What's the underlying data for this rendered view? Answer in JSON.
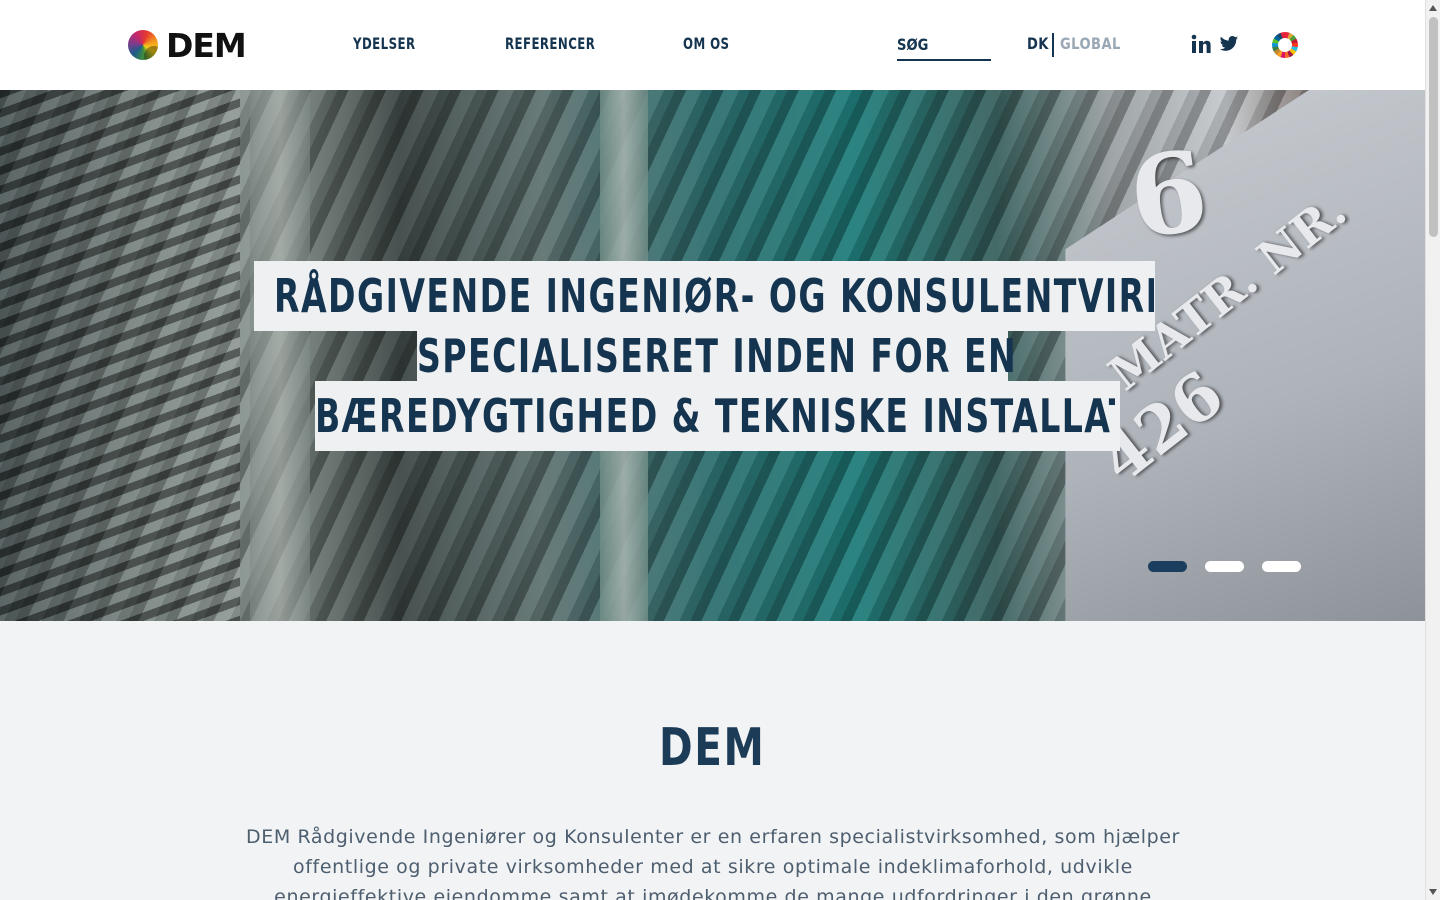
{
  "brand": {
    "logo_text": "DEM"
  },
  "nav": {
    "items": [
      {
        "label": "YDELSER"
      },
      {
        "label": "REFERENCER"
      },
      {
        "label": "OM OS"
      }
    ],
    "search_placeholder": "SØG",
    "lang_dk": "DK",
    "lang_global": "GLOBAL",
    "social": [
      {
        "icon": "linkedin-icon"
      },
      {
        "icon": "twitter-icon"
      }
    ],
    "sdg_icon": "sdg-wheel-icon"
  },
  "hero": {
    "lines": [
      "RÅDGIVENDE INGENIØR- OG KONSULENTVIRKSOMHED",
      "SPECIALISERET INDEN FOR ENERGI,",
      "BÆREDYGTIGHED & TEKNISKE INSTALLATIONER"
    ],
    "plate_number": "6",
    "plate_label": "MATR. NR.",
    "plate_code": "426",
    "slides": {
      "count": 3,
      "active_index": 0
    }
  },
  "about": {
    "title": "DEM",
    "text": "DEM Rådgivende Ingeniører og Konsulenter er en erfaren specialistvirksomhed, som hjælper offentlige og private virksomheder med at sikre optimale indeklimaforhold, udvikle energieffektive ejendomme samt at imødekomme de mange udfordringer i den grønne omstilling. FN’s verdensmål er"
  },
  "colors": {
    "navy": "#14344f",
    "slide_active": "#1b3e5e",
    "slide_inactive": "#ffffff",
    "lang_inactive": "#9aa8b6",
    "page_bg": "#f2f3f5"
  }
}
